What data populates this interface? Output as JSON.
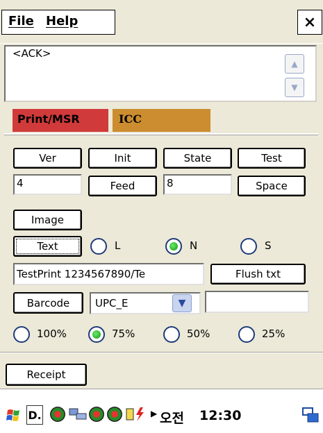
{
  "menu": {
    "file": "File",
    "help": "Help",
    "close": "×"
  },
  "ack": {
    "text": "<ACK>"
  },
  "tabs": {
    "print_msr": "Print/MSR",
    "icc": "ICC"
  },
  "buttons": {
    "ver": "Ver",
    "init": "Init",
    "state": "State",
    "test": "Test",
    "feed": "Feed",
    "space": "Space",
    "image": "Image",
    "text": "Text",
    "flush_txt": "Flush txt",
    "barcode": "Barcode",
    "receipt": "Receipt"
  },
  "fields": {
    "ver_value": "4",
    "feed_value": "8",
    "text_value": "TestPrint 1234567890/Te",
    "barcode_value": ""
  },
  "align": {
    "options": [
      "L",
      "N",
      "S"
    ],
    "selected": "N"
  },
  "barcode_type": {
    "selected": "UPC_E"
  },
  "scale": {
    "options": [
      "100%",
      "75%",
      "50%",
      "25%"
    ],
    "selected": "75%"
  },
  "taskbar": {
    "doc_label": "D.",
    "ime": "오전",
    "clock": "12:30"
  },
  "colors": {
    "tab_print": "#d13a3a",
    "tab_icc": "#cc8d30",
    "panel": "#ece9d8",
    "radio_selected": "#22bb22"
  },
  "icons": {
    "start": "windows-flag-icon",
    "network": "network-icon",
    "battery": "battery-icon",
    "keyboard": "keyboard-icon"
  }
}
